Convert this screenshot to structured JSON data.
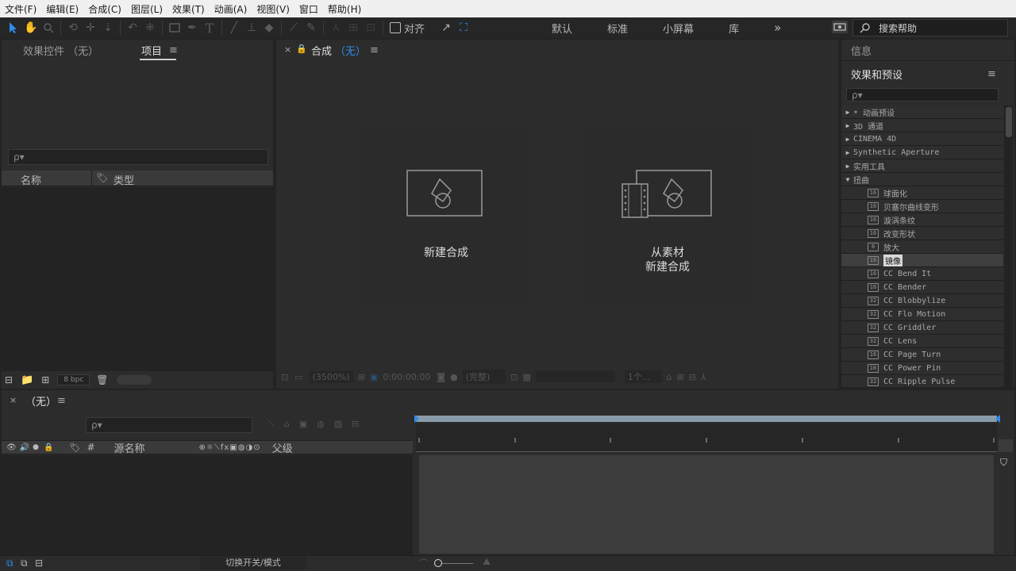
{
  "menu": [
    "文件(F)",
    "编辑(E)",
    "合成(C)",
    "图层(L)",
    "效果(T)",
    "动画(A)",
    "视图(V)",
    "窗口",
    "帮助(H)"
  ],
  "toolbar": {
    "snap_label": "对齐",
    "workspaces": [
      "默认",
      "标准",
      "小屏幕",
      "库"
    ],
    "overflow": "»",
    "search_help_placeholder": "搜索帮助"
  },
  "project_panel": {
    "tabs": [
      "效果控件 （无）",
      "项目"
    ],
    "search_placeholder": "ρ▾",
    "columns": [
      "名称",
      "类型"
    ],
    "bpc": "8 bpc"
  },
  "comp_panel": {
    "close": "×",
    "title": "合成",
    "comp_name": "（无）",
    "new_comp_label": "新建合成",
    "from_footage_line1": "从素材",
    "from_footage_line2": "新建合成",
    "zoom": "(3500%)",
    "timecode": "0:00:00:00",
    "resolution": "(完整)"
  },
  "right_panel": {
    "info_tab": "信息",
    "effects_tab": "效果和预设",
    "search_placeholder": "ρ▾",
    "categories": [
      {
        "label": "* 动画预设",
        "open": false
      },
      {
        "label": "3D 通道",
        "open": false
      },
      {
        "label": "CINEMA 4D",
        "open": false
      },
      {
        "label": "Synthetic Aperture",
        "open": false
      },
      {
        "label": "实用工具",
        "open": false
      },
      {
        "label": "扭曲",
        "open": true
      }
    ],
    "effects": [
      {
        "label": "球面化",
        "badge": "16",
        "selected": false
      },
      {
        "label": "贝塞尔曲线变形",
        "badge": "16",
        "selected": false
      },
      {
        "label": "漩涡条纹",
        "badge": "16",
        "selected": false
      },
      {
        "label": "改变形状",
        "badge": "16",
        "selected": false
      },
      {
        "label": "放大",
        "badge": "8",
        "selected": false
      },
      {
        "label": "镜像",
        "badge": "16",
        "selected": true
      },
      {
        "label": "CC Bend It",
        "badge": "16",
        "selected": false
      },
      {
        "label": "CC Bender",
        "badge": "16",
        "selected": false
      },
      {
        "label": "CC Blobbylize",
        "badge": "32",
        "selected": false
      },
      {
        "label": "CC Flo Motion",
        "badge": "32",
        "selected": false
      },
      {
        "label": "CC Griddler",
        "badge": "32",
        "selected": false
      },
      {
        "label": "CC Lens",
        "badge": "32",
        "selected": false
      },
      {
        "label": "CC Page Turn",
        "badge": "16",
        "selected": false
      },
      {
        "label": "CC Power Pin",
        "badge": "16",
        "selected": false
      },
      {
        "label": "CC Ripple Pulse",
        "badge": "32",
        "selected": false
      }
    ]
  },
  "timeline": {
    "close": "×",
    "comp_name": "（无）",
    "search_placeholder": "ρ▾",
    "col_hash": "#",
    "col_source_name": "源名称",
    "col_parent": "父级",
    "toggle_modes": "切换开关/模式"
  }
}
